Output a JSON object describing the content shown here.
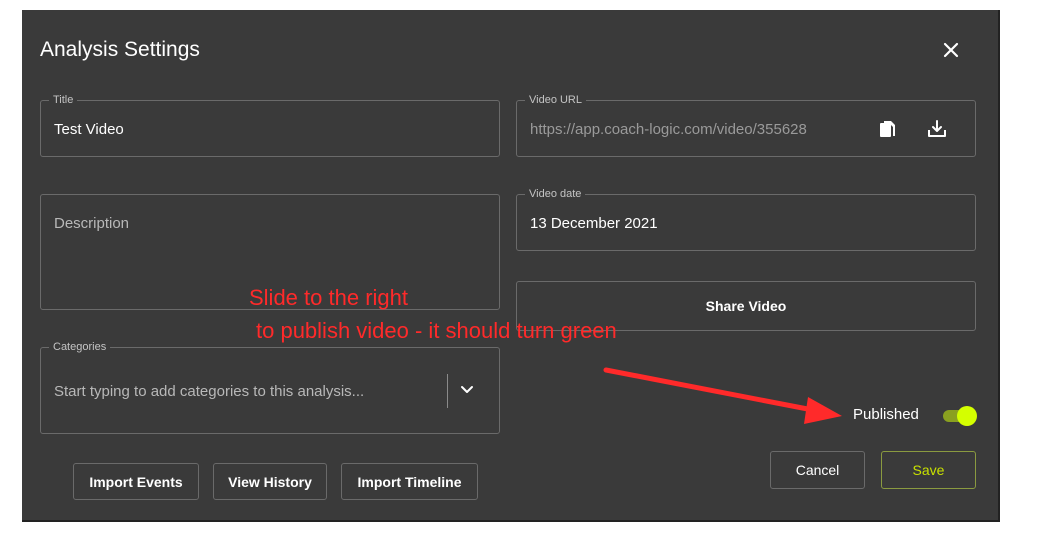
{
  "dialog": {
    "title": "Analysis Settings"
  },
  "fields": {
    "title_legend": "Title",
    "title_value": "Test Video",
    "video_url_legend": "Video URL",
    "video_url_value": "https://app.coach-logic.com/video/355628",
    "description_placeholder": "Description",
    "video_date_legend": "Video date",
    "video_date_value": "13 December 2021",
    "categories_legend": "Categories",
    "categories_placeholder": "Start typing to add categories to this analysis..."
  },
  "buttons": {
    "share_video": "Share Video",
    "import_events": "Import Events",
    "view_history": "View History",
    "import_timeline": "Import Timeline",
    "cancel": "Cancel",
    "save": "Save"
  },
  "publish": {
    "label": "Published",
    "enabled": true
  },
  "annotation": {
    "line1": "Slide to the right",
    "line2": "to publish video - it should turn green"
  },
  "icons": {
    "close": "close-icon",
    "copy": "copy-icon",
    "download": "download-icon",
    "dropdown": "chevron-down-icon"
  },
  "colors": {
    "dialog_bg": "#3a3a3a",
    "accent": "#d4ff00",
    "annotation": "#ff2a2a"
  }
}
